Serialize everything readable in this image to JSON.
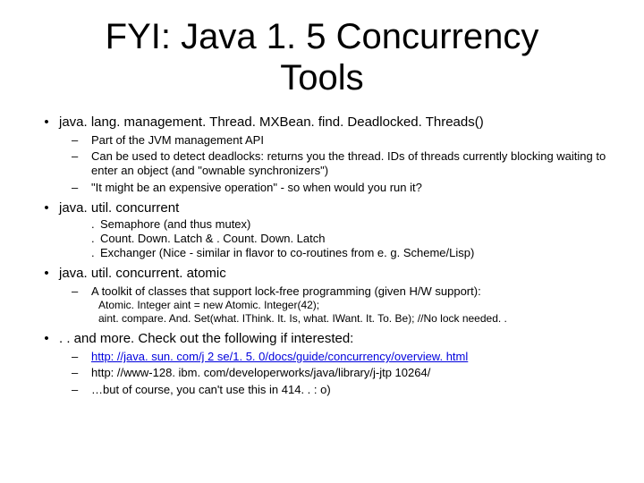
{
  "title_line1": "FYI: Java 1. 5 Concurrency",
  "title_line2": "Tools",
  "s1": {
    "head": "java. lang. management. Thread. MXBean. find. Deadlocked. Threads()",
    "p1": "Part of the JVM management API",
    "p2": "Can be used to detect deadlocks: returns you the thread. IDs of threads currently blocking waiting to enter an object (and \"ownable synchronizers\")",
    "p3": "\"It might be an expensive operation\" - so when would you run it?"
  },
  "s2": {
    "head": "java. util. concurrent",
    "p1": "Semaphore (and thus mutex)",
    "p2": "Count. Down. Latch & . Count. Down. Latch",
    "p3": "Exchanger (Nice - similar in flavor to co-routines from e. g. Scheme/Lisp)"
  },
  "s3": {
    "head": "java. util. concurrent. atomic",
    "p1": "A toolkit of classes that support lock-free programming (given H/W support):",
    "c1": "Atomic. Integer aint = new Atomic. Integer(42);",
    "c2": "aint. compare. And. Set(what. IThink. It. Is, what. IWant. It. To. Be); //No lock needed. ."
  },
  "s4": {
    "head": ". . and more. Check out the following if interested:",
    "link1": "http: //java. sun. com/j 2 se/1. 5. 0/docs/guide/concurrency/overview. html",
    "p2": "http: //www-128. ibm. com/developerworks/java/library/j-jtp 10264/",
    "p3": "…but of course, you can't use this in 414. . : o)"
  }
}
